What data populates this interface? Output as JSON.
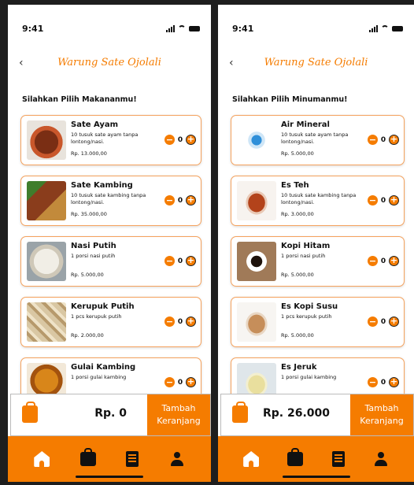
{
  "status": {
    "time": "9:41"
  },
  "app_title": "Warung Sate Ojolali",
  "food_screen": {
    "section_title": "Silahkan Pilih Makananmu!",
    "items": [
      {
        "name": "Sate Ayam",
        "desc": "10 tusuk sate ayam tanpa lontong/nasi.",
        "price": "Rp. 13.000,00",
        "qty": "0",
        "thumb": "sate-ayam"
      },
      {
        "name": "Sate Kambing",
        "desc": "10 tusuk sate kambing tanpa lontong/nasi.",
        "price": "Rp. 35.000,00",
        "qty": "0",
        "thumb": "sate-kambing"
      },
      {
        "name": "Nasi Putih",
        "desc": "1 porsi nasi putih",
        "price": "Rp. 5.000,00",
        "qty": "0",
        "thumb": "nasi"
      },
      {
        "name": "Kerupuk Putih",
        "desc": "1 pcs kerupuk putih",
        "price": "Rp. 2.000,00",
        "qty": "0",
        "thumb": "kerupuk"
      },
      {
        "name": "Gulai Kambing",
        "desc": "1 porsi gulai kambing",
        "price": "",
        "qty": "0",
        "thumb": "gulai"
      }
    ],
    "cart": {
      "total": "Rp. 0",
      "button": "Tambah Keranjang"
    }
  },
  "drink_screen": {
    "section_title": "Silahkan Pilih Minumanmu!",
    "items": [
      {
        "name": "Air Mineral",
        "desc": "10 tusuk sate ayam tanpa lontong/nasi.",
        "price": "Rp. 5.000,00",
        "qty": "0",
        "thumb": "air"
      },
      {
        "name": "Es Teh",
        "desc": "10 tusuk sate kambing tanpa lontong/nasi.",
        "price": "Rp. 3.000,00",
        "qty": "0",
        "thumb": "esteh"
      },
      {
        "name": "Kopi Hitam",
        "desc": "1 porsi nasi putih",
        "price": "Rp. 5.000,00",
        "qty": "0",
        "thumb": "kopi"
      },
      {
        "name": "Es Kopi Susu",
        "desc": "1 pcs kerupuk putih",
        "price": "Rp. 5.000,00",
        "qty": "0",
        "thumb": "kopisusu"
      },
      {
        "name": "Es Jeruk",
        "desc": "1 porsi gulai kambing",
        "price": "",
        "qty": "0",
        "thumb": "jeruk"
      }
    ],
    "cart": {
      "total": "Rp. 26.000",
      "button": "Tambah Keranjang"
    }
  },
  "stepper": {
    "minus": "−",
    "plus": "+"
  },
  "back": "‹",
  "icons": {
    "back": "chevron-left-icon",
    "cart": "shopping-bag-icon",
    "nav": [
      "home-icon",
      "shop-icon",
      "orders-icon",
      "profile-icon"
    ]
  },
  "colors": {
    "accent": "#f57c00",
    "card_border": "#f5a25d"
  }
}
